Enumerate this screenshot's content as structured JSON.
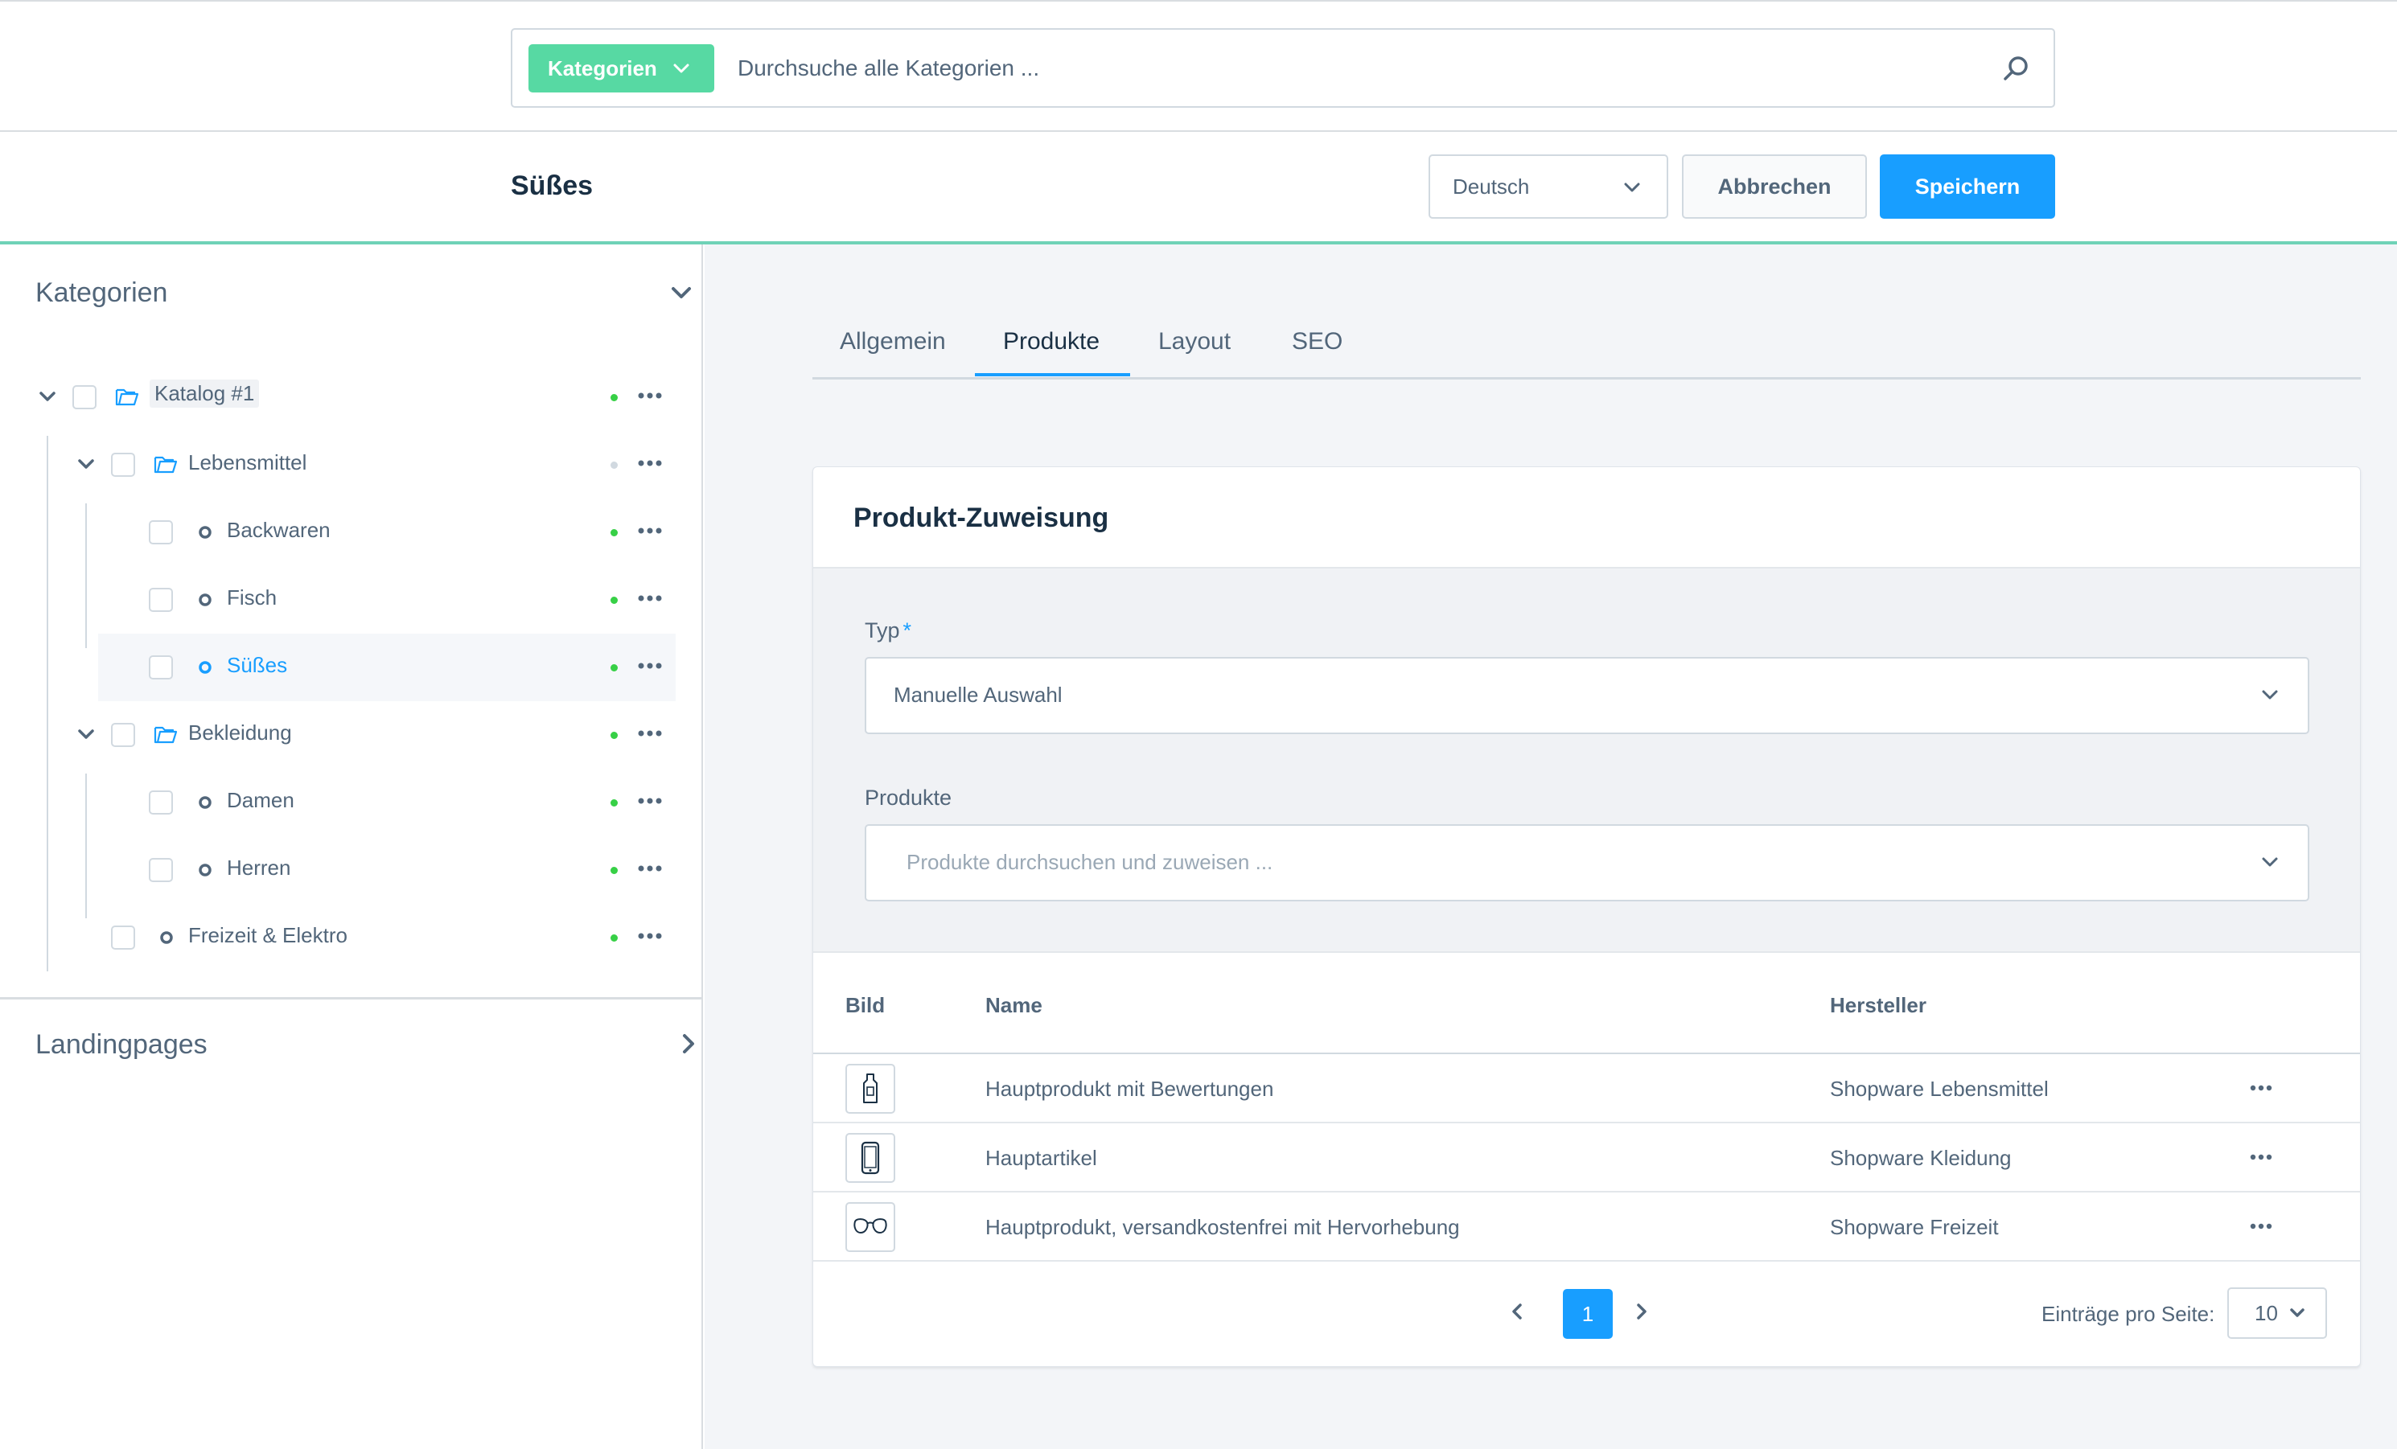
{
  "search": {
    "type_label": "Kategorien",
    "placeholder": "Durchsuche alle Kategorien ..."
  },
  "smartbar": {
    "title": "Süßes",
    "language": "Deutsch",
    "cancel_label": "Abbrechen",
    "save_label": "Speichern"
  },
  "sidebar": {
    "categories_title": "Kategorien",
    "landingpages_title": "Landingpages",
    "tree": [
      {
        "label": "Katalog #1",
        "status": "active"
      },
      {
        "label": "Lebensmittel",
        "status": "inactive"
      },
      {
        "label": "Backwaren",
        "status": "active"
      },
      {
        "label": "Fisch",
        "status": "active"
      },
      {
        "label": "Süßes",
        "status": "active",
        "selected": true
      },
      {
        "label": "Bekleidung",
        "status": "active"
      },
      {
        "label": "Damen",
        "status": "active"
      },
      {
        "label": "Herren",
        "status": "active"
      },
      {
        "label": "Freizeit & Elektro",
        "status": "active"
      }
    ]
  },
  "tabs": [
    {
      "label": "Allgemein"
    },
    {
      "label": "Produkte",
      "active": true
    },
    {
      "label": "Layout"
    },
    {
      "label": "SEO"
    }
  ],
  "assignment": {
    "title": "Produkt-Zuweisung",
    "type_label": "Typ",
    "required_mark": "*",
    "type_value": "Manuelle Auswahl",
    "products_label": "Produkte",
    "products_placeholder": "Produkte durchsuchen und zuweisen ..."
  },
  "grid": {
    "columns": [
      "Bild",
      "Name",
      "Hersteller"
    ],
    "rows": [
      {
        "name": "Hauptprodukt mit Bewertungen",
        "manufacturer": "Shopware Lebensmittel",
        "image_icon": "bottle-icon"
      },
      {
        "name": "Hauptartikel",
        "manufacturer": "Shopware Kleidung",
        "image_icon": "smartphone-icon"
      },
      {
        "name": "Hauptprodukt, versandkostenfrei mit Hervorhebung",
        "manufacturer": "Shopware Freizeit",
        "image_icon": "glasses-icon"
      }
    ]
  },
  "pagination": {
    "current_page": "1",
    "per_page_label": "Einträge pro Seite:",
    "per_page_value": "10"
  },
  "colors": {
    "primary": "#189eff",
    "search_type_bg": "#57d9a3",
    "status_active": "#37d046",
    "status_inactive": "#d1d9e0",
    "smartbar_border": "#6fd2b7"
  }
}
